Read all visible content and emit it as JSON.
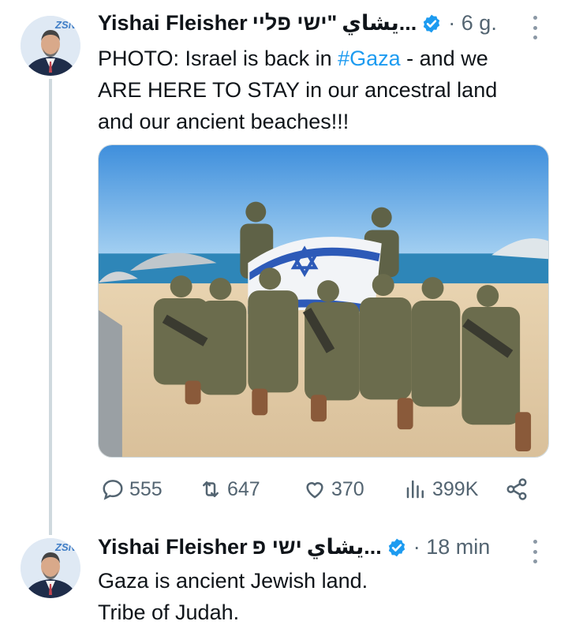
{
  "tweets": [
    {
      "author_name": "Yishai Fleisher",
      "author_name_hebrew": "ישי פליי\"",
      "handle_arabic": "يشاي...",
      "time": "· 6 g.",
      "text_line1": "PHOTO: Israel is back in ",
      "hashtag": "#Gaza",
      "text_line1_rest": " - and we",
      "text_line2": "ARE HERE TO STAY in our ancestral land",
      "text_line3": "and our ancient beaches!!!",
      "stats": {
        "replies": "555",
        "reposts": "647",
        "likes": "370",
        "views": "399K"
      }
    },
    {
      "author_name": "Yishai Fleisher",
      "author_name_hebrew": "ישי פ",
      "handle_arabic": "يشاي...",
      "time": "· 18 min",
      "text_line1": "Gaza is ancient Jewish land.",
      "text_line2": "Tribe of Judah."
    }
  ],
  "icons": {
    "reply": "speech-bubble-icon",
    "repost": "repost-arrows-icon",
    "like": "heart-icon",
    "views": "bar-chart-icon",
    "share": "share-icon",
    "verified": "verified-badge-icon",
    "more": "more-vertical-icon"
  },
  "colors": {
    "accent": "#1d9bf0",
    "secondary_text": "#536471",
    "thread_line": "#cfd9de"
  }
}
